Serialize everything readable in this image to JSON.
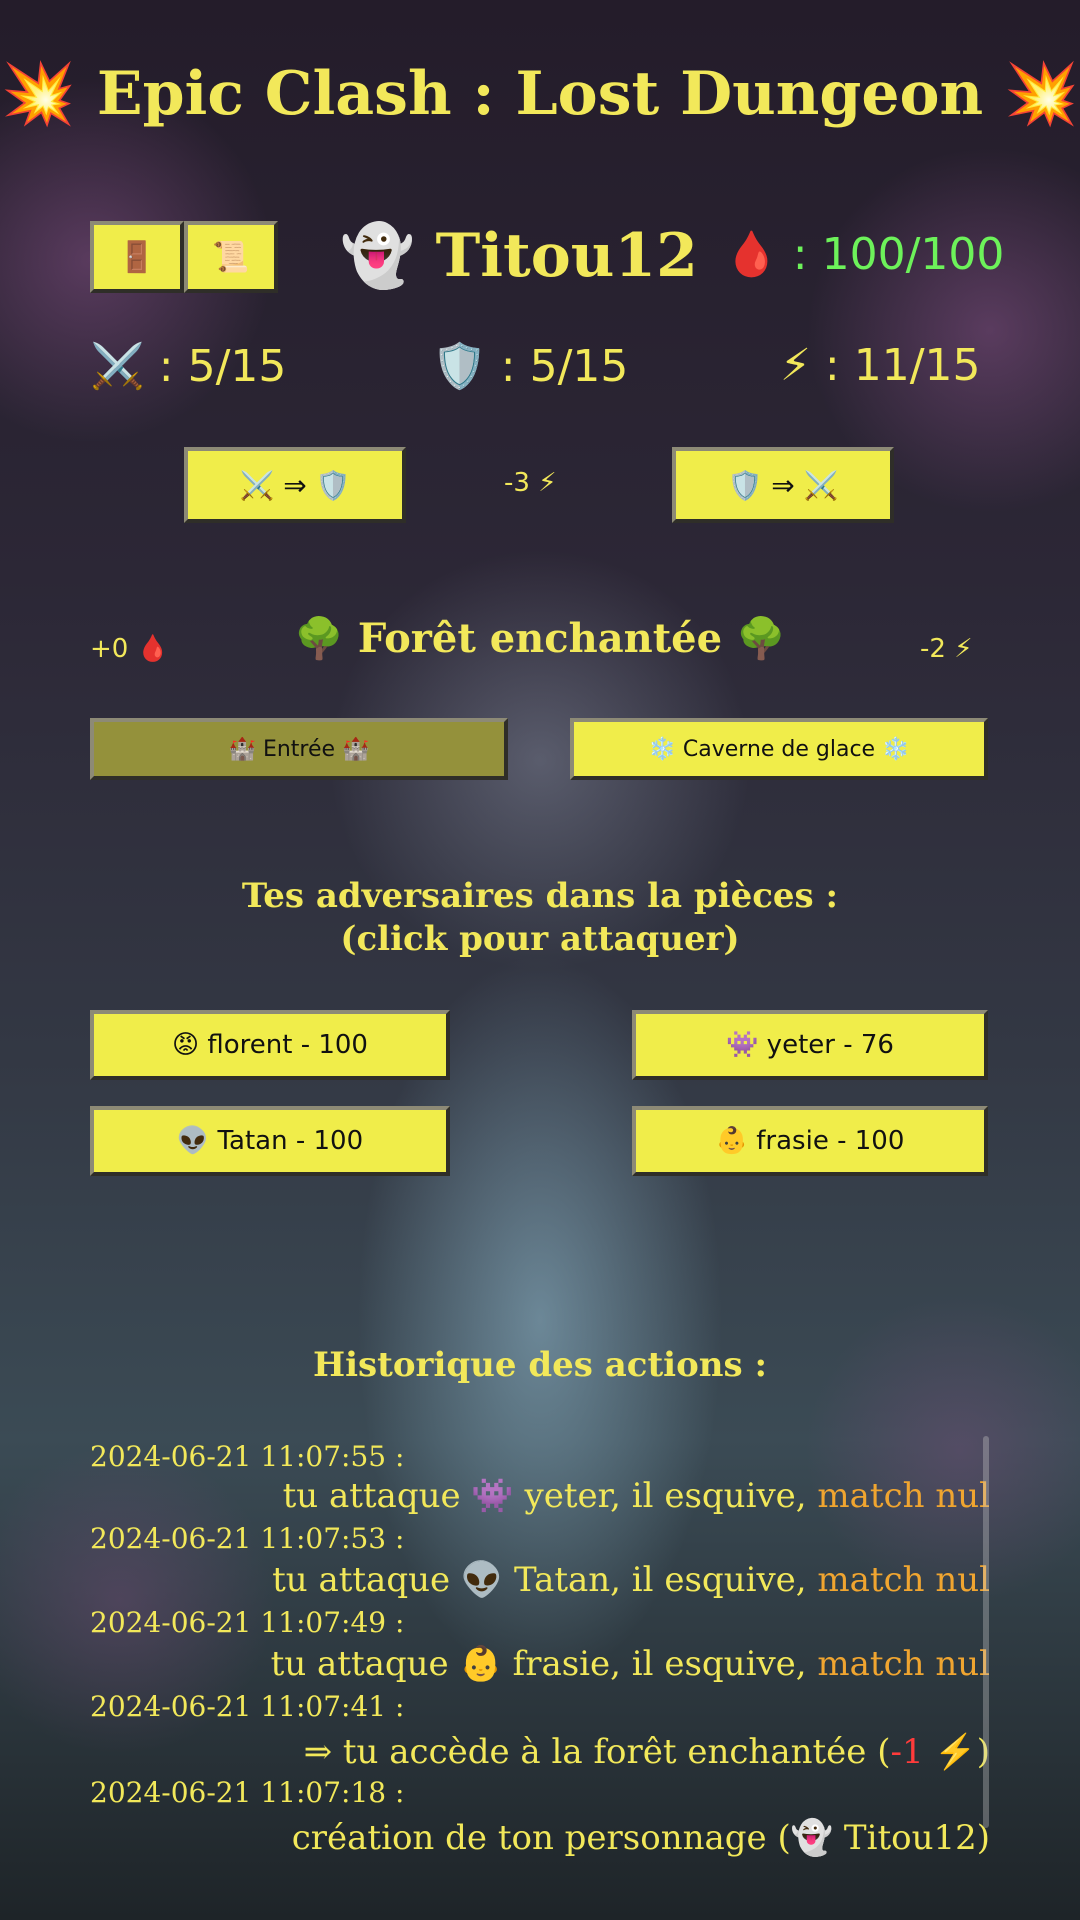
{
  "app": {
    "title": "Epic Clash : Lost Dungeon",
    "title_icon": "💥"
  },
  "colors": {
    "button_bg": "#f0ed4a",
    "button_active_bg": "#94913b",
    "text_yellow": "#f2e85a",
    "hp_green": "#6df25a",
    "orange": "#f0a530",
    "red": "#ff3b3b"
  },
  "toolbar": {
    "door_icon": "🚪",
    "scroll_icon": "📜"
  },
  "player": {
    "avatar": "👻",
    "name": "Titou12",
    "hp_icon": "🩸",
    "hp": ": 100/100"
  },
  "stats": {
    "attack_icon": "⚔️",
    "attack": ": 5/15",
    "defense_icon": "🛡️",
    "defense": ": 5/15",
    "energy_icon": "⚡",
    "energy": ": 11/15"
  },
  "convert": {
    "atk_to_def": "⚔️ ⇒ 🛡️",
    "def_to_atk": "🛡️ ⇒ ⚔️",
    "cost": "-3 ⚡"
  },
  "room": {
    "name": "🌳 Forêt enchantée 🌳",
    "hp_gain": "+0 🩸",
    "energy_cost": "-2 ⚡",
    "exits": [
      {
        "label": "🏰 Entrée 🏰",
        "active": true
      },
      {
        "label": "❄️ Caverne de glace ❄️",
        "active": false
      }
    ]
  },
  "opponents": {
    "title_line1": "Tes adversaires dans la pièces :",
    "title_line2": "(click pour attaquer)",
    "list": [
      {
        "label": "😡 florent - 100"
      },
      {
        "label": "👾 yeter - 76"
      },
      {
        "label": "👽 Tatan - 100"
      },
      {
        "label": "👶 frasie - 100"
      }
    ]
  },
  "history": {
    "title": "Historique des actions :",
    "entries": [
      {
        "ts": "2024-06-21 11:07:55 :",
        "text": "tu attaque 👾 yeter, il esquive, ",
        "highlight": "match nul"
      },
      {
        "ts": "2024-06-21 11:07:53 :",
        "text": "tu attaque 👽 Tatan, il esquive, ",
        "highlight": "match nul"
      },
      {
        "ts": "2024-06-21 11:07:49 :",
        "text": "tu attaque 👶 frasie, il esquive, ",
        "highlight": "match nul"
      },
      {
        "ts": "2024-06-21 11:07:41 :",
        "text": "⇒ tu accède à la forêt enchantée (",
        "red": "-1",
        "end": " ⚡)"
      },
      {
        "ts": "2024-06-21 11:07:18 :",
        "text": "création de ton personnage (👻 Titou12)"
      }
    ]
  }
}
